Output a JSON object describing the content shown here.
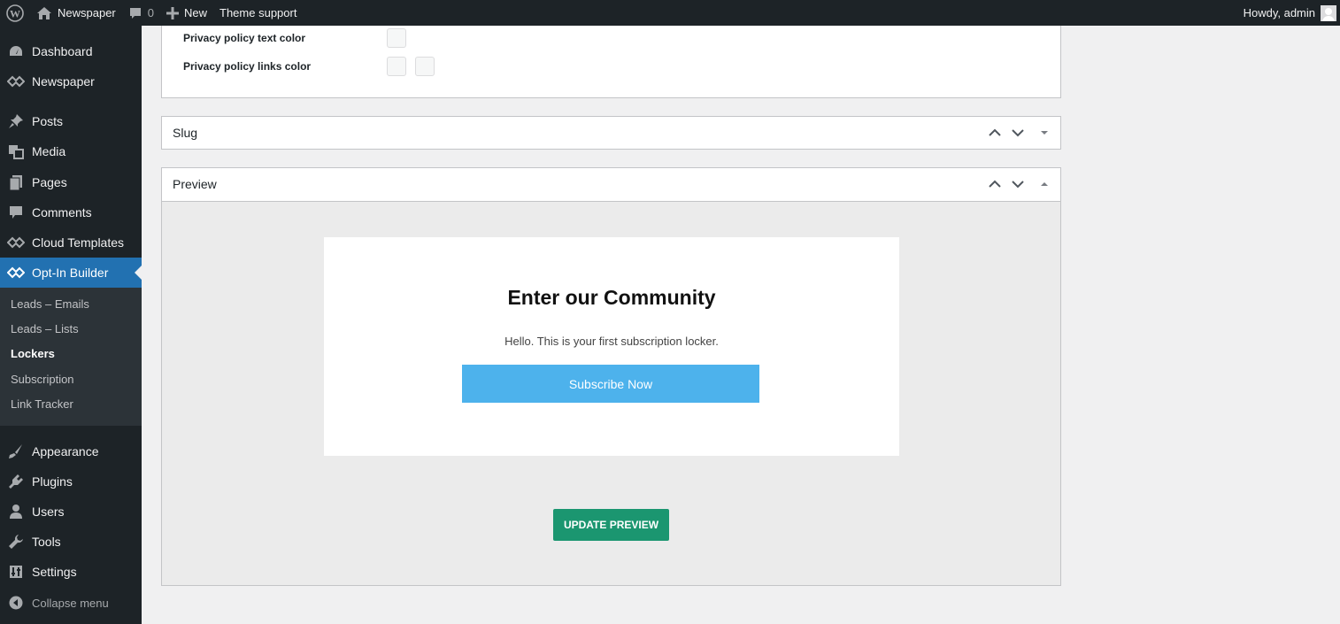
{
  "adminbar": {
    "site_name": "Newspaper",
    "comments_count": "0",
    "new_label": "New",
    "theme_support": "Theme support",
    "howdy": "Howdy, admin"
  },
  "sidebar": {
    "items": [
      {
        "label": "Dashboard",
        "icon": "dashboard-icon"
      },
      {
        "label": "Newspaper",
        "icon": "newspaper-logo-icon"
      },
      {
        "label": "Posts",
        "icon": "pin-icon"
      },
      {
        "label": "Media",
        "icon": "media-icon"
      },
      {
        "label": "Pages",
        "icon": "pages-icon"
      },
      {
        "label": "Comments",
        "icon": "comment-icon"
      },
      {
        "label": "Cloud Templates",
        "icon": "cloud-templates-icon"
      },
      {
        "label": "Opt-In Builder",
        "icon": "optin-builder-icon"
      },
      {
        "label": "Appearance",
        "icon": "brush-icon"
      },
      {
        "label": "Plugins",
        "icon": "plug-icon"
      },
      {
        "label": "Users",
        "icon": "user-icon"
      },
      {
        "label": "Tools",
        "icon": "wrench-icon"
      },
      {
        "label": "Settings",
        "icon": "settings-icon"
      }
    ],
    "submenu": [
      "Leads – Emails",
      "Leads – Lists",
      "Lockers",
      "Subscription",
      "Link Tracker"
    ],
    "collapse_label": "Collapse menu"
  },
  "privacy": {
    "text_color_label": "Privacy policy text color",
    "links_color_label": "Privacy policy links color"
  },
  "slug": {
    "title": "Slug"
  },
  "preview": {
    "title": "Preview",
    "locker_title": "Enter our Community",
    "locker_text": "Hello. This is your first subscription locker.",
    "subscribe_label": "Subscribe Now",
    "update_label": "UPDATE PREVIEW"
  },
  "colors": {
    "adminbar_bg": "#1d2327",
    "active_menu": "#2271b1",
    "subscribe_button": "#4db2ec",
    "update_button": "#1b9670"
  }
}
